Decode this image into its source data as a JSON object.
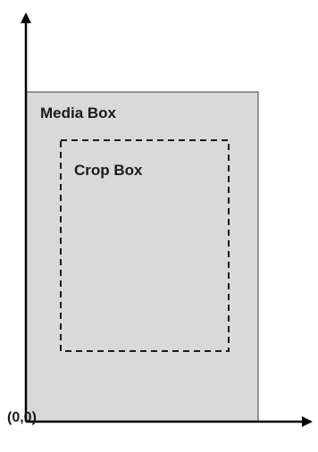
{
  "diagram": {
    "media_box_label": "Media Box",
    "crop_box_label": "Crop Box",
    "origin_label": "(0,0)",
    "colors": {
      "media_box_fill": "#d9d9d9",
      "media_box_stroke": "#3a3a3a",
      "crop_box_stroke": "#1a1a1a",
      "axis": "#000000"
    }
  }
}
